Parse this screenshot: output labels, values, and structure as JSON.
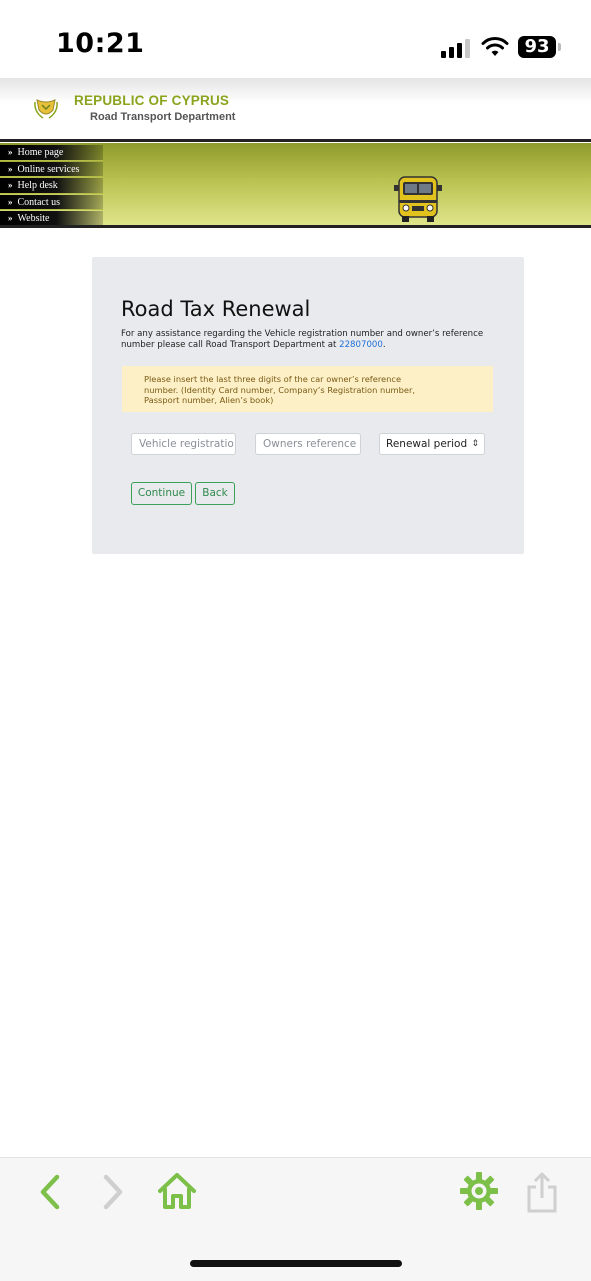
{
  "status_bar": {
    "time": "10:21",
    "battery": "93"
  },
  "site": {
    "title": "REPUBLIC OF CYPRUS",
    "subtitle": "Road Transport Department"
  },
  "nav": {
    "items": [
      {
        "label": "Home page"
      },
      {
        "label": "Online services"
      },
      {
        "label": "Help desk"
      },
      {
        "label": "Contact us"
      },
      {
        "label": "Website"
      }
    ]
  },
  "form": {
    "title": "Road Tax Renewal",
    "assist_text": "For any assistance regarding the Vehicle registration number and owner’s reference number please call Road Transport Department at ",
    "phone": "22807000",
    "assist_end": ".",
    "alert": "Please insert the last three digits of the car owner’s reference number. (Identity Card number, Company’s Registration number, Passport number, Alien’s book)",
    "vehicle_placeholder": "Vehicle registratio",
    "owner_placeholder": "Owners reference",
    "renewal_selected": "Renewal period",
    "continue_label": "Continue",
    "back_label": "Back"
  },
  "colors": {
    "accent_green": "#3aa05a",
    "brand_olive": "#8aa51d",
    "link_blue": "#1e6fd9",
    "toolbar_icon_green": "#7cc04a"
  },
  "toolbar": {
    "icons": [
      "back-arrow-icon",
      "forward-arrow-icon",
      "home-icon",
      "settings-gear-icon",
      "share-icon"
    ]
  }
}
